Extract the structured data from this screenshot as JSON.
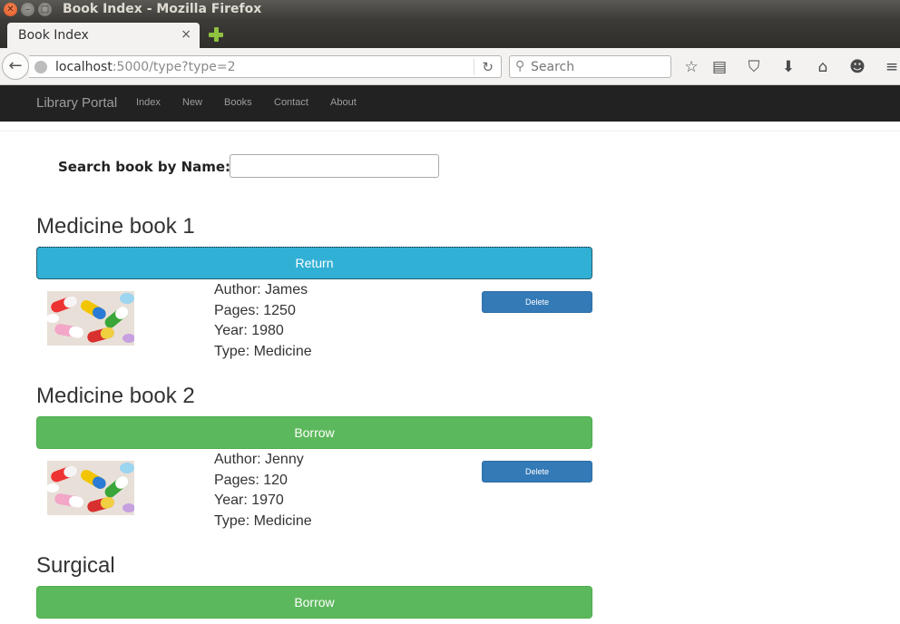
{
  "window": {
    "title": "Book Index - Mozilla Firefox"
  },
  "tab": {
    "title": "Book Index",
    "close": "×",
    "new_tab_icon": "plus-icon"
  },
  "browser": {
    "url_host": "localhost",
    "url_rest": ":5000/type?type=2",
    "search_placeholder": "Search"
  },
  "site": {
    "brand": "Library Portal",
    "nav": [
      "Index",
      "New",
      "Books",
      "Contact",
      "About"
    ]
  },
  "search": {
    "label": "Search book by Name:",
    "value": ""
  },
  "books": [
    {
      "title": "Medicine book 1",
      "action": "Return",
      "author": "Author: James",
      "pages": "Pages: 1250",
      "year": "Year: 1980",
      "type": "Type: Medicine",
      "delete": "Delete"
    },
    {
      "title": "Medicine book 2",
      "action": "Borrow",
      "author": "Author: Jenny",
      "pages": "Pages: 120",
      "year": "Year: 1970",
      "type": "Type: Medicine",
      "delete": "Delete"
    },
    {
      "title": "Surgical",
      "action": "Borrow"
    }
  ],
  "colors": {
    "return_button": "#31b0d5",
    "borrow_button": "#5cb85c",
    "delete_button": "#337ab7",
    "site_navbar": "#222222"
  }
}
